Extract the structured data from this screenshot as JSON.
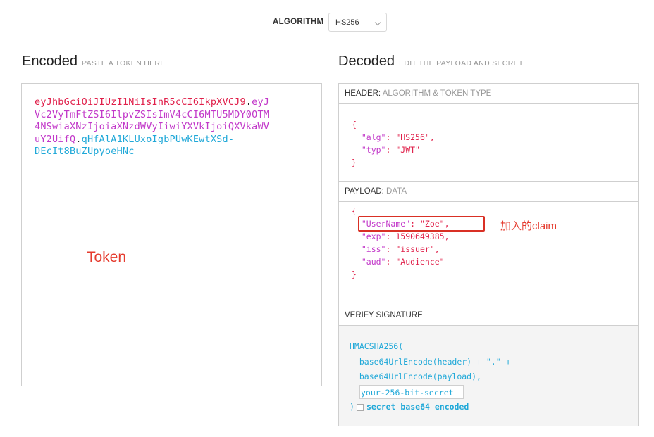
{
  "algorithm": {
    "label": "ALGORITHM",
    "selected": "HS256"
  },
  "encoded": {
    "title": "Encoded",
    "subtitle": "PASTE A TOKEN HERE",
    "token_lines": [
      {
        "part": "header",
        "text": "eyJhbGciOiJIUzI1NiIsInR5cCI6IkpXVCJ9"
      },
      {
        "part": "dot",
        "text": "."
      },
      {
        "part": "payload",
        "text": "eyJ"
      },
      {
        "part": "payload",
        "text": "Vc2VyTmFtZSI6IlpvZSIsImV4cCI6MTU5MDY0OTM"
      },
      {
        "part": "payload",
        "text": "4NSwiaXNzIjoiaXNzdWVyIiwiYXVkIjoiQXVkaWV"
      },
      {
        "part": "payload",
        "text": "uY2UifQ"
      },
      {
        "part": "dot",
        "text": "."
      },
      {
        "part": "sig",
        "text": "qHfAlA1KLUxoIgbPUwKEwtXSd-"
      },
      {
        "part": "sig",
        "text": "DEcIt8BuZUpyoeHNc"
      }
    ],
    "annotation": "Token"
  },
  "decoded": {
    "title": "Decoded",
    "subtitle": "EDIT THE PAYLOAD AND SECRET",
    "header_panel": {
      "label": "HEADER:",
      "sub": "ALGORITHM & TOKEN TYPE",
      "open": "{",
      "alg_key": "\"alg\"",
      "alg_val": "\"HS256\"",
      "typ_key": "\"typ\"",
      "typ_val": "\"JWT\"",
      "close": "}"
    },
    "payload_panel": {
      "label": "PAYLOAD:",
      "sub": "DATA",
      "open": "{",
      "username_key": "\"UserName\"",
      "username_val": "\"Zoe\"",
      "exp_key": "\"exp\"",
      "exp_val": "1590649385",
      "iss_key": "\"iss\"",
      "iss_val": "\"issuer\"",
      "aud_key": "\"aud\"",
      "aud_val": "\"Audience\"",
      "close": "}",
      "annotation": "加入的claim"
    },
    "verify_panel": {
      "label": "VERIFY SIGNATURE",
      "fn": "HMACSHA256(",
      "line1": "base64UrlEncode(header) + \".\" +",
      "line2": "base64UrlEncode(payload),",
      "secret_placeholder": "your-256-bit-secret",
      "close": ")",
      "b64_label": "secret base64 encoded"
    }
  },
  "colors": {
    "header": "#e0204a",
    "payload": "#c238c9",
    "signature": "#1fa8d8",
    "annotation": "#e53c2f"
  }
}
